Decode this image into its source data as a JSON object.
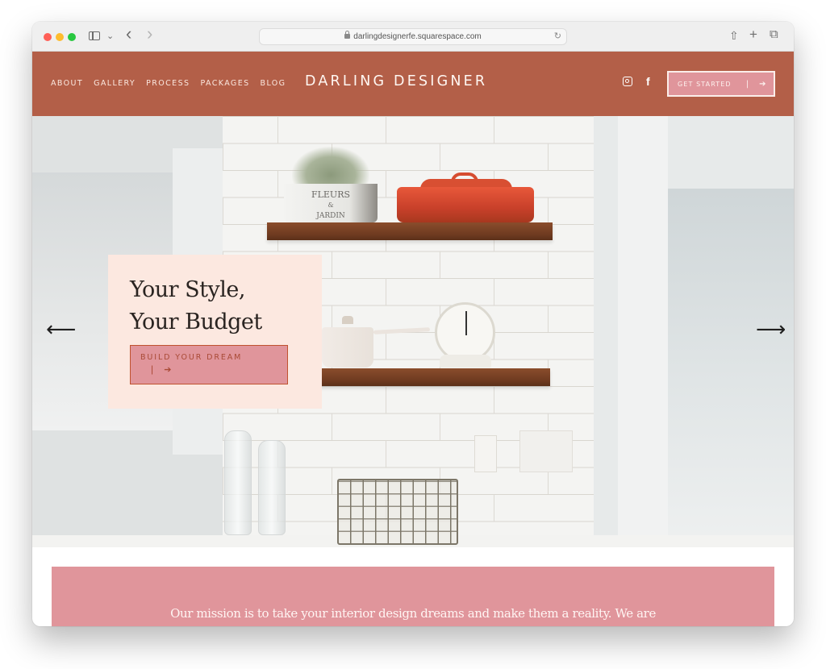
{
  "browser": {
    "url": "darlingdesignerfe.squarespace.com",
    "icons": {
      "sidebar": "sidebar-icon",
      "chevron": "chevron-down-icon",
      "back": "back-icon",
      "forward": "forward-icon",
      "lock": "lock-icon",
      "reload": "reload-icon",
      "share": "share-icon",
      "new_tab": "plus-icon",
      "tabs": "tab-overview-icon"
    },
    "glyphs": {
      "chevron": "⌄",
      "back": "‹",
      "forward": "›",
      "reload": "↻",
      "share": "⇧",
      "new_tab": "+",
      "tabs": "⧉"
    }
  },
  "header": {
    "nav": [
      "ABOUT",
      "GALLERY",
      "PROCESS",
      "PACKAGES",
      "BLOG"
    ],
    "brand": "DARLING DESIGNER",
    "social": {
      "instagram": "instagram-icon",
      "facebook": "f"
    },
    "cta": {
      "label": "GET STARTED",
      "separator": "|",
      "arrow": "➔"
    }
  },
  "hero": {
    "title_line1": "Your Style,",
    "title_line2": "Your Budget",
    "cta": {
      "label": "BUILD YOUR DREAM",
      "separator": "|",
      "arrow": "➔"
    },
    "prev_arrow": "⟵",
    "next_arrow": "⟶",
    "planter_text_1": "FLEURS",
    "planter_text_2": "&",
    "planter_text_3": "JARDIN"
  },
  "mission": {
    "text": "Our mission is to take your interior design dreams and make them a reality. We are"
  },
  "colors": {
    "header_bg": "#b35f48",
    "accent_pink": "#e0959b",
    "card_bg": "#fce8e0",
    "cta_border": "#c0522f"
  }
}
